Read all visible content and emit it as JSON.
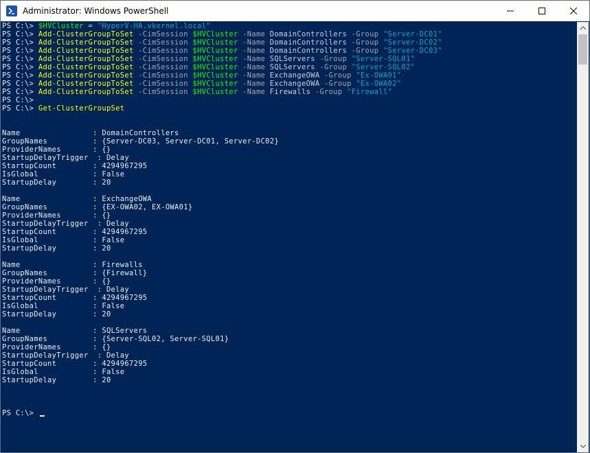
{
  "window": {
    "title": "Administrator: Windows PowerShell",
    "icon": "powershell-icon",
    "controls": [
      "minimize-icon",
      "maximize-icon",
      "close-icon"
    ]
  },
  "colors": {
    "background": "#012456",
    "text": "#eeedf0",
    "command": "#ffff00",
    "variable": "#00ff00",
    "string": "#00a8c8",
    "parameter": "#a8a8a8"
  },
  "console": {
    "prompt": "PS C:\\> ",
    "commands": [
      [
        {
          "t": "var",
          "v": "$HVCluster"
        },
        {
          "t": "op",
          "v": " = "
        },
        {
          "t": "str",
          "v": "\"HyperV-HA.vkernel.local\""
        }
      ],
      [
        {
          "t": "cmd",
          "v": "Add-ClusterGroupToSet"
        },
        {
          "t": "param",
          "v": " -CimSession "
        },
        {
          "t": "var",
          "v": "$HVCluster"
        },
        {
          "t": "param",
          "v": " -Name "
        },
        {
          "t": "op",
          "v": "DomainControllers"
        },
        {
          "t": "param",
          "v": " -Group "
        },
        {
          "t": "str",
          "v": "\"Server-DC01\""
        }
      ],
      [
        {
          "t": "cmd",
          "v": "Add-ClusterGroupToSet"
        },
        {
          "t": "param",
          "v": " -CimSession "
        },
        {
          "t": "var",
          "v": "$HVCluster"
        },
        {
          "t": "param",
          "v": " -Name "
        },
        {
          "t": "op",
          "v": "DomainControllers"
        },
        {
          "t": "param",
          "v": " -Group "
        },
        {
          "t": "str",
          "v": "\"Server-DC02\""
        }
      ],
      [
        {
          "t": "cmd",
          "v": "Add-ClusterGroupToSet"
        },
        {
          "t": "param",
          "v": " -CimSession "
        },
        {
          "t": "var",
          "v": "$HVCluster"
        },
        {
          "t": "param",
          "v": " -Name "
        },
        {
          "t": "op",
          "v": "DomainControllers"
        },
        {
          "t": "param",
          "v": " -Group "
        },
        {
          "t": "str",
          "v": "\"Server-DC03\""
        }
      ],
      [
        {
          "t": "cmd",
          "v": "Add-ClusterGroupToSet"
        },
        {
          "t": "param",
          "v": " -CimSession "
        },
        {
          "t": "var",
          "v": "$HVCluster"
        },
        {
          "t": "param",
          "v": " -Name "
        },
        {
          "t": "op",
          "v": "SQLServers"
        },
        {
          "t": "param",
          "v": " -Group "
        },
        {
          "t": "str",
          "v": "\"Server-SQL01\""
        }
      ],
      [
        {
          "t": "cmd",
          "v": "Add-ClusterGroupToSet"
        },
        {
          "t": "param",
          "v": " -CimSession "
        },
        {
          "t": "var",
          "v": "$HVCluster"
        },
        {
          "t": "param",
          "v": " -Name "
        },
        {
          "t": "op",
          "v": "SQLServers"
        },
        {
          "t": "param",
          "v": " -Group "
        },
        {
          "t": "str",
          "v": "\"Server-SQL02\""
        }
      ],
      [
        {
          "t": "cmd",
          "v": "Add-ClusterGroupToSet"
        },
        {
          "t": "param",
          "v": " -CimSession "
        },
        {
          "t": "var",
          "v": "$HVCluster"
        },
        {
          "t": "param",
          "v": " -Name "
        },
        {
          "t": "op",
          "v": "ExchangeOWA"
        },
        {
          "t": "param",
          "v": " -Group "
        },
        {
          "t": "str",
          "v": "\"Ex-OWA01\""
        }
      ],
      [
        {
          "t": "cmd",
          "v": "Add-ClusterGroupToSet"
        },
        {
          "t": "param",
          "v": " -CimSession "
        },
        {
          "t": "var",
          "v": "$HVCluster"
        },
        {
          "t": "param",
          "v": " -Name "
        },
        {
          "t": "op",
          "v": "ExchangeOWA"
        },
        {
          "t": "param",
          "v": " -Group "
        },
        {
          "t": "str",
          "v": "\"Ex-OWA02\""
        }
      ],
      [
        {
          "t": "cmd",
          "v": "Add-ClusterGroupToSet"
        },
        {
          "t": "param",
          "v": " -CimSession "
        },
        {
          "t": "var",
          "v": "$HVCluster"
        },
        {
          "t": "param",
          "v": " -Name "
        },
        {
          "t": "op",
          "v": "Firewalls"
        },
        {
          "t": "param",
          "v": " -Group "
        },
        {
          "t": "str",
          "v": "\"Firewall\""
        }
      ],
      [],
      [
        {
          "t": "cmd",
          "v": "Get-ClusterGroupSet"
        }
      ]
    ],
    "property_names": [
      "Name",
      "GroupNames",
      "ProviderNames",
      "StartupDelayTrigger",
      "StartupCount",
      "IsGlobal",
      "StartupDelay"
    ],
    "results": [
      [
        "DomainControllers",
        "{Server-DC03, Server-DC01, Server-DC02}",
        "{}",
        "Delay",
        "4294967295",
        "False",
        "20"
      ],
      [
        "ExchangeOWA",
        "{EX-OWA02, EX-OWA01}",
        "{}",
        "Delay",
        "4294967295",
        "False",
        "20"
      ],
      [
        "Firewalls",
        "{Firewall}",
        "{}",
        "Delay",
        "4294967295",
        "False",
        "20"
      ],
      [
        "SQLServers",
        "{Server-SQL02, Server-SQL01}",
        "{}",
        "Delay",
        "4294967295",
        "False",
        "20"
      ]
    ],
    "final_prompt": "PS C:\\> "
  }
}
